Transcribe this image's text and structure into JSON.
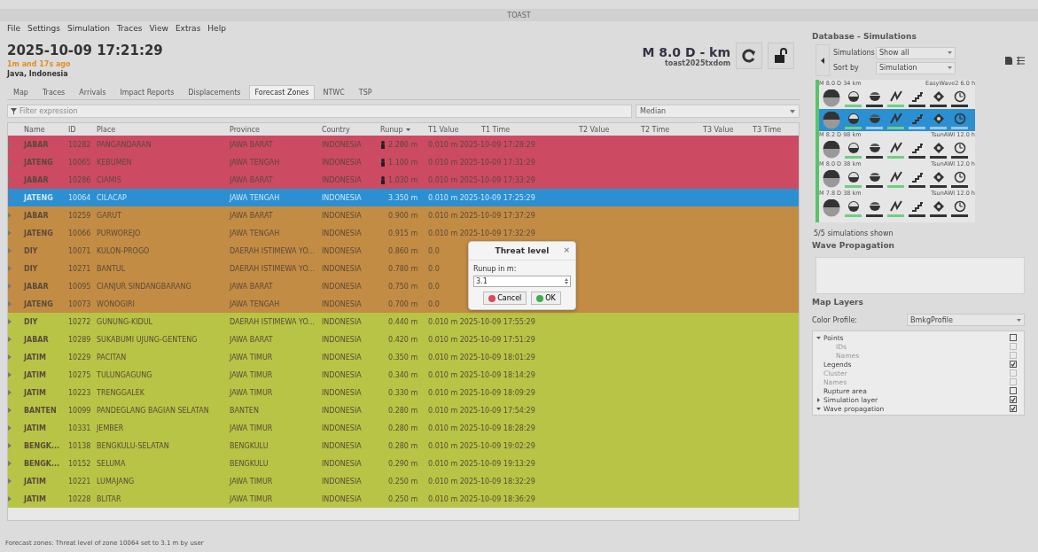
{
  "window": {
    "title": "TOAST"
  },
  "menu": [
    "File",
    "Settings",
    "Simulation",
    "Traces",
    "View",
    "Extras",
    "Help"
  ],
  "event": {
    "time": "2025-10-09 17:21:29",
    "ago": "1m and 17s ago",
    "region": "Java, Indonesia",
    "magnitude": "M 8.0  D - km",
    "id": "toast2025txdom"
  },
  "tabs": [
    {
      "label": "Map",
      "selected": false
    },
    {
      "label": "Traces",
      "selected": false
    },
    {
      "label": "Arrivals",
      "selected": false
    },
    {
      "label": "Impact Reports",
      "selected": false
    },
    {
      "label": "Displacements",
      "selected": false
    },
    {
      "label": "Forecast Zones",
      "selected": true
    },
    {
      "label": "NTWC",
      "selected": false
    },
    {
      "label": "TSP",
      "selected": false
    }
  ],
  "filter": {
    "placeholder": "Filter expression",
    "mode": "Median"
  },
  "table": {
    "columns": [
      "Name",
      "ID",
      "Place",
      "Province",
      "Country",
      "Runup",
      "T1 Value",
      "T1 Time",
      "T2 Value",
      "T2 Time",
      "T3 Value",
      "T3 Time"
    ],
    "rows": [
      {
        "cells": [
          "JABAR",
          "10282",
          "PANGANDARAN",
          "JAWA BARAT",
          "INDONESIA",
          "2.280 m",
          "0.010 m 2025-10-09 17:28:29"
        ],
        "color": "#cc4a62",
        "flag": true,
        "selected": false
      },
      {
        "cells": [
          "JATENG",
          "10065",
          "KEBUMEN",
          "JAWA TENGAH",
          "INDONESIA",
          "1.100 m",
          "0.010 m 2025-10-09 17:31:29"
        ],
        "color": "#cc4a62",
        "flag": true,
        "selected": false
      },
      {
        "cells": [
          "JABAR",
          "10286",
          "CIAMIS",
          "JAWA BARAT",
          "INDONESIA",
          "1.030 m",
          "0.010 m 2025-10-09 17:33:29"
        ],
        "color": "#cc4a62",
        "flag": true,
        "selected": false
      },
      {
        "cells": [
          "JATENG",
          "10064",
          "CILACAP",
          "JAWA TENGAH",
          "INDONESIA",
          "3.350 m",
          "0.010 m 2025-10-09 17:25:29"
        ],
        "flag": false,
        "selected": true
      },
      {
        "cells": [
          "JABAR",
          "10259",
          "GARUT",
          "JAWA BARAT",
          "INDONESIA",
          "0.900 m",
          "0.010 m 2025-10-09 17:37:29"
        ],
        "color": "#c38c44",
        "flag": false,
        "selected": false
      },
      {
        "cells": [
          "JATENG",
          "10066",
          "PURWOREJO",
          "JAWA TENGAH",
          "INDONESIA",
          "0.915 m",
          "0.010 m 2025-10-09 17:32:29"
        ],
        "color": "#c38c44",
        "flag": false,
        "selected": false
      },
      {
        "cells": [
          "DIY",
          "10071",
          "KULON-PROGO",
          "DAERAH ISTIMEWA YO...",
          "INDONESIA",
          "0.860 m",
          "0.0"
        ],
        "color": "#c38c44",
        "flag": false,
        "selected": false
      },
      {
        "cells": [
          "DIY",
          "10271",
          "BANTUL",
          "DAERAH ISTIMEWA YO...",
          "INDONESIA",
          "0.780 m",
          "0.0"
        ],
        "color": "#c38c44",
        "flag": false,
        "selected": false
      },
      {
        "cells": [
          "JABAR",
          "10095",
          "CIANJUR SINDANGBARANG",
          "JAWA BARAT",
          "INDONESIA",
          "0.750 m",
          "0.0"
        ],
        "color": "#c38c44",
        "flag": false,
        "selected": false
      },
      {
        "cells": [
          "JATENG",
          "10073",
          "WONOGIRI",
          "JAWA TENGAH",
          "INDONESIA",
          "0.700 m",
          "0.0"
        ],
        "color": "#c38c44",
        "flag": false,
        "selected": false
      },
      {
        "cells": [
          "DIY",
          "10272",
          "GUNUNG-KIDUL",
          "DAERAH ISTIMEWA YO...",
          "INDONESIA",
          "0.440 m",
          "0.010 m 2025-10-09 17:55:29"
        ],
        "color": "#b8c445",
        "flag": false,
        "selected": false
      },
      {
        "cells": [
          "JABAR",
          "10289",
          "SUKABUMI UJUNG-GENTENG",
          "JAWA BARAT",
          "INDONESIA",
          "0.420 m",
          "0.010 m 2025-10-09 17:51:29"
        ],
        "color": "#b8c445",
        "flag": false,
        "selected": false
      },
      {
        "cells": [
          "JATIM",
          "10229",
          "PACITAN",
          "JAWA TIMUR",
          "INDONESIA",
          "0.350 m",
          "0.010 m 2025-10-09 18:01:29"
        ],
        "color": "#b8c445",
        "flag": false,
        "selected": false
      },
      {
        "cells": [
          "JATIM",
          "10275",
          "TULUNGAGUNG",
          "JAWA TIMUR",
          "INDONESIA",
          "0.340 m",
          "0.010 m 2025-10-09 18:14:29"
        ],
        "color": "#b8c445",
        "flag": false,
        "selected": false
      },
      {
        "cells": [
          "JATIM",
          "10223",
          "TRENGGALEK",
          "JAWA TIMUR",
          "INDONESIA",
          "0.330 m",
          "0.010 m 2025-10-09 18:09:29"
        ],
        "color": "#b8c445",
        "flag": false,
        "selected": false
      },
      {
        "cells": [
          "BANTEN",
          "10099",
          "PANDEGLANG BAGIAN SELATAN",
          "BANTEN",
          "INDONESIA",
          "0.280 m",
          "0.010 m 2025-10-09 17:54:29"
        ],
        "color": "#b8c445",
        "flag": false,
        "selected": false
      },
      {
        "cells": [
          "JATIM",
          "10331",
          "JEMBER",
          "JAWA TIMUR",
          "INDONESIA",
          "0.280 m",
          "0.010 m 2025-10-09 18:28:29"
        ],
        "color": "#b8c445",
        "flag": false,
        "selected": false
      },
      {
        "cells": [
          "BENGK...",
          "10138",
          "BENGKULU-SELATAN",
          "BENGKULU",
          "INDONESIA",
          "0.280 m",
          "0.010 m 2025-10-09 19:02:29"
        ],
        "color": "#b8c445",
        "flag": false,
        "selected": false
      },
      {
        "cells": [
          "BENGK...",
          "10152",
          "SELUMA",
          "BENGKULU",
          "INDONESIA",
          "0.290 m",
          "0.010 m 2025-10-09 19:13:29"
        ],
        "color": "#b8c445",
        "flag": false,
        "selected": false
      },
      {
        "cells": [
          "JATIM",
          "10221",
          "LUMAJANG",
          "JAWA TIMUR",
          "INDONESIA",
          "0.250 m",
          "0.010 m 2025-10-09 18:32:29"
        ],
        "color": "#b8c445",
        "flag": false,
        "selected": false
      },
      {
        "cells": [
          "JATIM",
          "10228",
          "BLITAR",
          "JAWA TIMUR",
          "INDONESIA",
          "0.250 m",
          "0.010 m 2025-10-09 18:36:29"
        ],
        "color": "#b8c445",
        "flag": false,
        "selected": false
      }
    ]
  },
  "dialog": {
    "title": "Threat level",
    "close": "×",
    "label": "Runup in m:",
    "value": "3.1",
    "buttons": [
      "Cancel",
      "OK"
    ]
  },
  "status_bar": "Forecast zones: Threat level of zone 10064 set to 3.1 m by user",
  "database": {
    "title": "Database - Simulations",
    "filter_label": "Simulations",
    "filter_value": "Show all",
    "sort_label": "Sort by",
    "sort_value": "Simulation",
    "simulations": [
      {
        "heading": "M 8.0  D 34 km",
        "model": "EasyWave2 6.0 h",
        "selected": false,
        "indicators": [
          true,
          false,
          true,
          false,
          false,
          false
        ]
      },
      {
        "selected": true,
        "indicators": [
          true,
          false,
          true,
          false,
          false,
          false
        ]
      },
      {
        "heading": "M 8.2  D 98 km",
        "model": "TsunAWI 12.0 h",
        "selected": false,
        "indicators": [
          true,
          false,
          true,
          false,
          false,
          false
        ]
      },
      {
        "heading": "M 8.0  D 38 km",
        "model": "TsunAWI 12.0 h",
        "selected": false,
        "indicators": [
          true,
          false,
          true,
          false,
          false,
          false
        ]
      },
      {
        "heading": "M 7.8  D 38 km",
        "model": "TsunAWI 12.0 h",
        "selected": false,
        "indicators": [
          true,
          false,
          true,
          false,
          false,
          false
        ]
      }
    ],
    "summary": "5/5 simulations shown"
  },
  "wave_propagation": {
    "title": "Wave Propagation"
  },
  "map_layers": {
    "title": "Map Layers",
    "profile_label": "Color Profile:",
    "profile": "BmkgProfile",
    "tree": [
      {
        "label": "Points",
        "checked": false,
        "expanded": true,
        "children": [
          {
            "label": "IDs",
            "checked": false,
            "disabled": true
          },
          {
            "label": "Names",
            "checked": false,
            "disabled": true
          }
        ]
      },
      {
        "label": "Legends",
        "checked": true
      },
      {
        "label": "Cluster",
        "checked": false,
        "disabled": true
      },
      {
        "label": "Names",
        "checked": false,
        "disabled": true
      },
      {
        "label": "Rupture area",
        "checked": false
      },
      {
        "label": "Simulation layer",
        "checked": true,
        "expanded": false
      },
      {
        "label": "Wave propagation",
        "checked": true,
        "expanded": true
      }
    ]
  }
}
